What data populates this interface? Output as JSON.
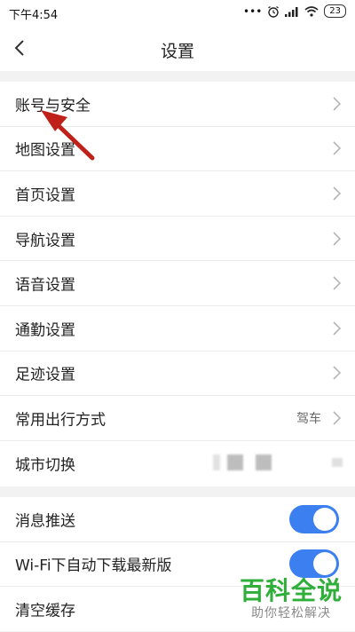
{
  "status": {
    "time": "下午4:54",
    "icons": [
      "dots-icon",
      "alarm-icon",
      "signal-icon",
      "wifi-icon"
    ],
    "battery": "23"
  },
  "header": {
    "title": "设置"
  },
  "group1": {
    "items": [
      {
        "label": "账号与安全"
      },
      {
        "label": "地图设置"
      },
      {
        "label": "首页设置"
      },
      {
        "label": "导航设置"
      },
      {
        "label": "语音设置"
      },
      {
        "label": "通勤设置"
      },
      {
        "label": "足迹设置"
      },
      {
        "label": "常用出行方式",
        "value": "驾车"
      },
      {
        "label": "城市切换"
      }
    ]
  },
  "group2": {
    "items": [
      {
        "label": "消息推送",
        "toggle_on": true
      },
      {
        "label": "Wi-Fi下自动下载最新版",
        "toggle_on": true
      },
      {
        "label": "清空缓存"
      }
    ]
  },
  "watermark": {
    "title": "百科全说",
    "subtitle": "助你轻松解决"
  },
  "colors": {
    "toggle_on": "#3b7ff0",
    "annotation_arrow": "#c0201a",
    "watermark_green": "#2fae3a"
  }
}
